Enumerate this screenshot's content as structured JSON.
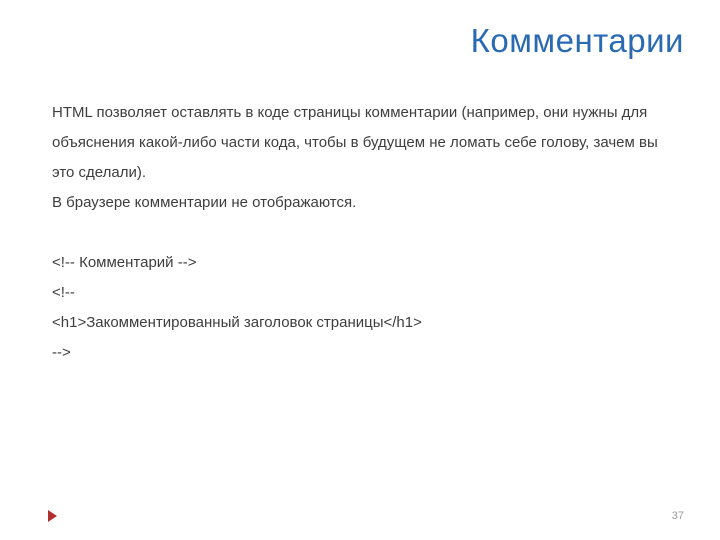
{
  "title": "Комментарии",
  "body": {
    "p1": "HTML позволяет оставлять в коде страницы комментарии (например, они нужны для объяснения какой-либо части кода, чтобы в будущем не ломать себе голову, зачем вы это сделали).",
    "p2": "В браузере комментарии не отображаются.",
    "code1": "<!-- Комментарий -->",
    "code2": "<!--",
    "code3": "<h1>Закомментированный заголовок страницы</h1>",
    "code4": "-->"
  },
  "pageNumber": "37"
}
